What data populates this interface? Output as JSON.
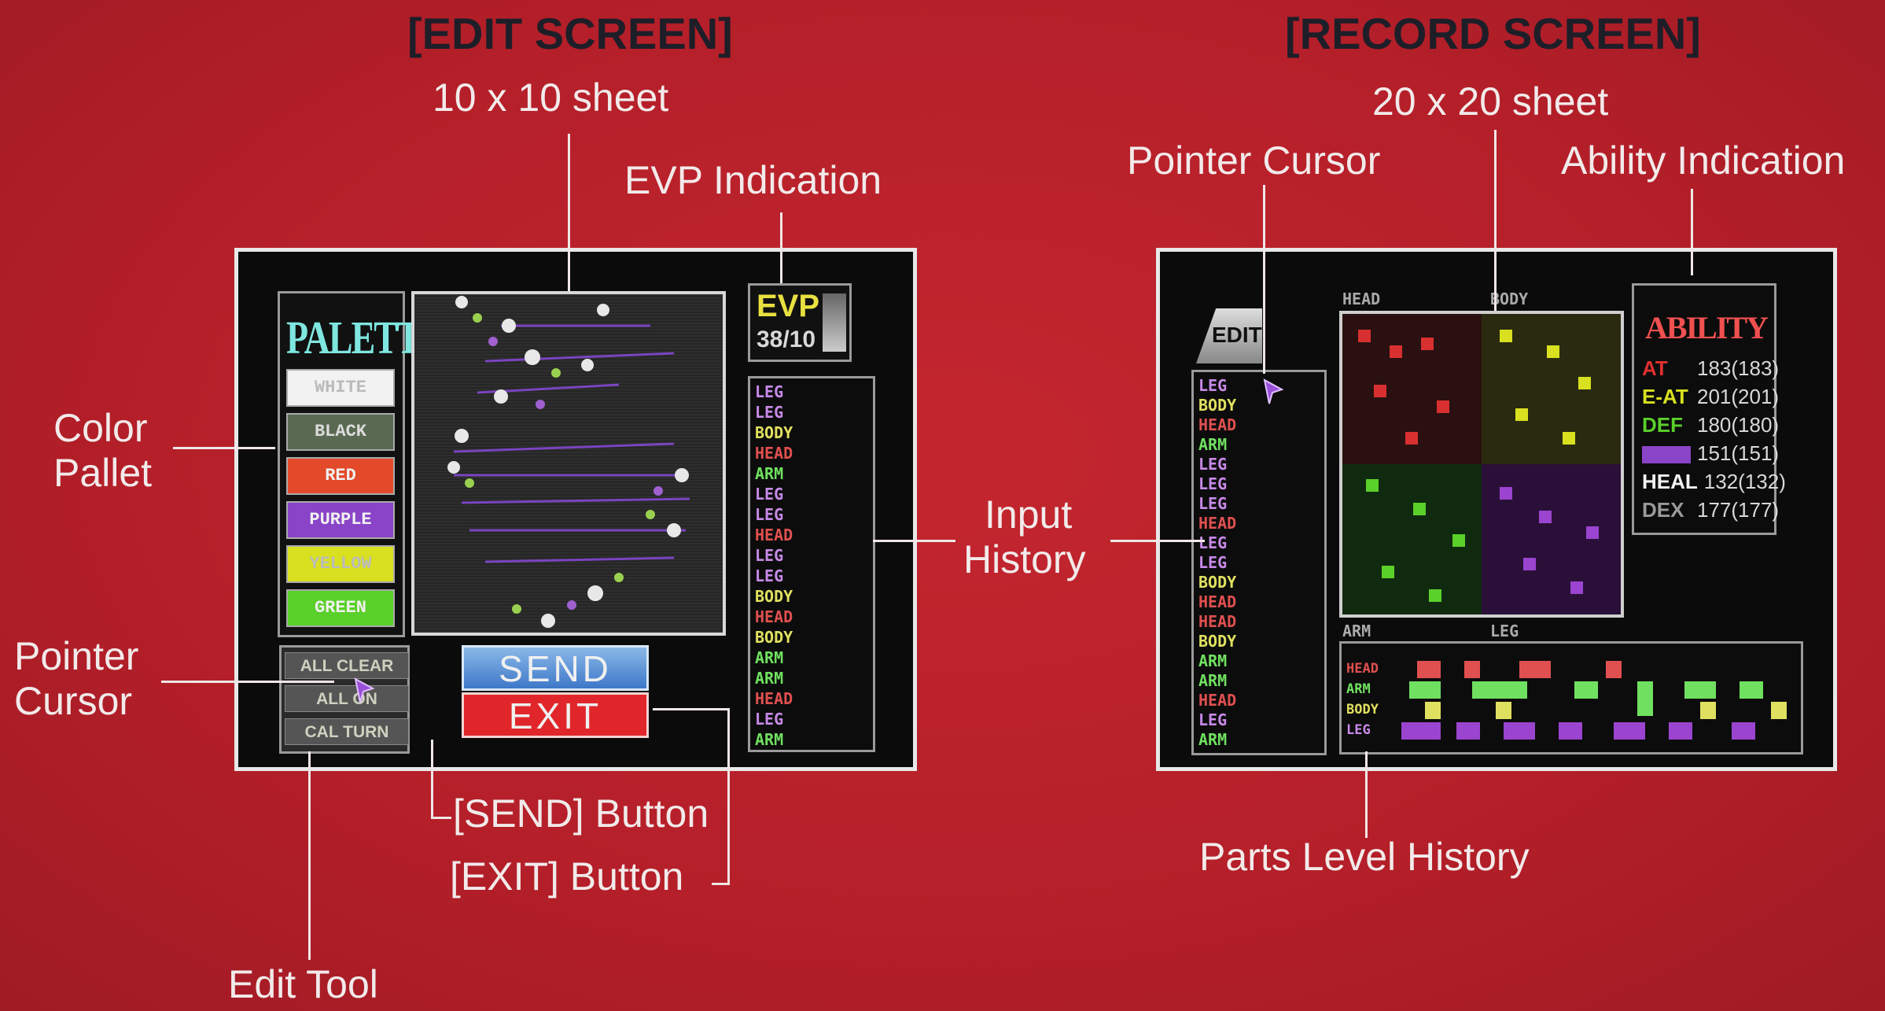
{
  "headers": {
    "edit_title": "[EDIT SCREEN]",
    "edit_subtitle": "10 x 10 sheet",
    "record_title": "[RECORD SCREEN]",
    "record_subtitle": "20 x 20 sheet"
  },
  "annotations": {
    "evp_indication": "EVP Indication",
    "color_pallet_1": "Color",
    "color_pallet_2": "Pallet",
    "pointer_cursor_left_1": "Pointer",
    "pointer_cursor_left_2": "Cursor",
    "edit_tool": "Edit Tool",
    "send_button": "[SEND] Button",
    "exit_button": "[EXIT] Button",
    "input_history_1": "Input",
    "input_history_2": "History",
    "pointer_cursor_right": "Pointer Cursor",
    "ability_indication": "Ability Indication",
    "parts_level_history": "Parts Level History"
  },
  "edit_screen": {
    "palette_title": "PALETTE",
    "palette": [
      {
        "label": "WHITE",
        "color": "#f2f2f2"
      },
      {
        "label": "BLACK",
        "color": "#5a6a52"
      },
      {
        "label": "RED",
        "color": "#e24a2a"
      },
      {
        "label": "PURPLE",
        "color": "#8a44c8"
      },
      {
        "label": "YELLOW",
        "color": "#d8e020"
      },
      {
        "label": "GREEN",
        "color": "#5ad02a"
      }
    ],
    "tools": [
      "ALL CLEAR",
      "ALL ON",
      "CAL TURN"
    ],
    "evp_label": "EVP",
    "evp_value": "38/10",
    "send_label": "SEND",
    "exit_label": "EXIT",
    "history": [
      {
        "part": "LEG",
        "color": "#c88ae8"
      },
      {
        "part": "LEG",
        "color": "#c88ae8"
      },
      {
        "part": "BODY",
        "color": "#e0e060"
      },
      {
        "part": "HEAD",
        "color": "#e05050"
      },
      {
        "part": "ARM",
        "color": "#70e060"
      },
      {
        "part": "LEG",
        "color": "#c88ae8"
      },
      {
        "part": "LEG",
        "color": "#c88ae8"
      },
      {
        "part": "HEAD",
        "color": "#e05050"
      },
      {
        "part": "LEG",
        "color": "#c88ae8"
      },
      {
        "part": "LEG",
        "color": "#c88ae8"
      },
      {
        "part": "BODY",
        "color": "#e0e060"
      },
      {
        "part": "HEAD",
        "color": "#e05050"
      },
      {
        "part": "BODY",
        "color": "#e0e060"
      },
      {
        "part": "ARM",
        "color": "#70e060"
      },
      {
        "part": "ARM",
        "color": "#70e060"
      },
      {
        "part": "HEAD",
        "color": "#e05050"
      },
      {
        "part": "LEG",
        "color": "#c88ae8"
      },
      {
        "part": "ARM",
        "color": "#70e060"
      }
    ]
  },
  "record_screen": {
    "edit_tab": "EDIT",
    "sheet_labels": {
      "top_left": "HEAD",
      "top_right": "BODY",
      "bottom_left": "ARM",
      "bottom_right": "LEG"
    },
    "history": [
      {
        "part": "LEG",
        "color": "#c88ae8"
      },
      {
        "part": "BODY",
        "color": "#e0e060"
      },
      {
        "part": "HEAD",
        "color": "#e05050"
      },
      {
        "part": "ARM",
        "color": "#70e060"
      },
      {
        "part": "LEG",
        "color": "#c88ae8"
      },
      {
        "part": "LEG",
        "color": "#c88ae8"
      },
      {
        "part": "LEG",
        "color": "#c88ae8"
      },
      {
        "part": "HEAD",
        "color": "#e05050"
      },
      {
        "part": "LEG",
        "color": "#c88ae8"
      },
      {
        "part": "LEG",
        "color": "#c88ae8"
      },
      {
        "part": "BODY",
        "color": "#e0e060"
      },
      {
        "part": "HEAD",
        "color": "#e05050"
      },
      {
        "part": "HEAD",
        "color": "#e05050"
      },
      {
        "part": "BODY",
        "color": "#e0e060"
      },
      {
        "part": "ARM",
        "color": "#70e060"
      },
      {
        "part": "ARM",
        "color": "#70e060"
      },
      {
        "part": "HEAD",
        "color": "#e05050"
      },
      {
        "part": "LEG",
        "color": "#c88ae8"
      },
      {
        "part": "ARM",
        "color": "#70e060"
      }
    ],
    "ability_title": "ABILITY",
    "abilities": [
      {
        "name": "AT",
        "value": "183(183)",
        "color": "#e03030"
      },
      {
        "name": "E-AT",
        "value": "201(201)",
        "color": "#d8e020"
      },
      {
        "name": "DEF",
        "value": "180(180)",
        "color": "#5ad02a"
      },
      {
        "name": "",
        "value": "151(151)",
        "color": "#8a44c8"
      },
      {
        "name": "HEAL",
        "value": "132(132)",
        "color": "#f2f2f2"
      },
      {
        "name": "DEX",
        "value": "177(177)",
        "color": "#9a9a9a"
      }
    ],
    "parts_history_rows": [
      {
        "label": "HEAD",
        "color": "#e05050"
      },
      {
        "label": "ARM",
        "color": "#70e060"
      },
      {
        "label": "BODY",
        "color": "#e0e060"
      },
      {
        "label": "LEG",
        "color": "#c88ae8"
      }
    ]
  }
}
